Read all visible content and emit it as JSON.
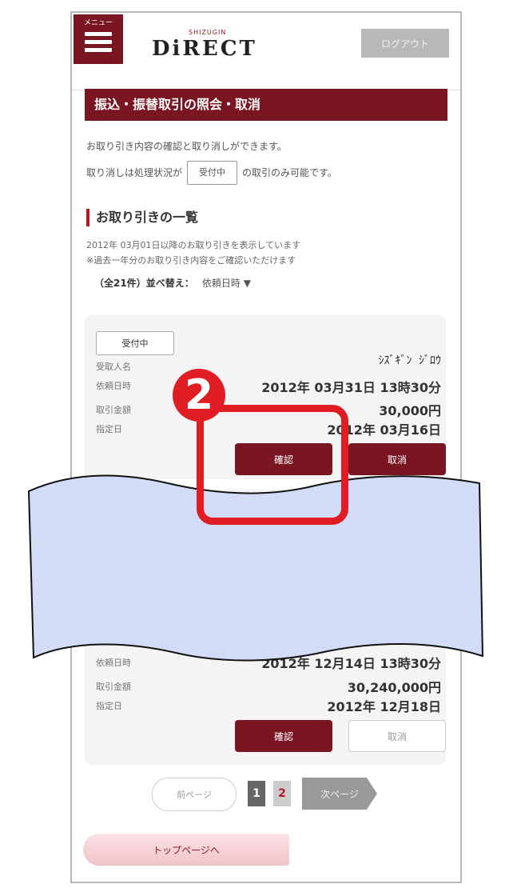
{
  "header": {
    "menu_label": "メニュー",
    "logo_small": "SHIZUGIN",
    "logo_main": "DiRECT",
    "logout_label": "ログアウト"
  },
  "page": {
    "title": "振込・振替取引の照会・取消",
    "desc_line1": "お取り引き内容の確認と取り消しができます。",
    "desc_line2_prefix": "取り消しは処理状況が",
    "desc_line2_badge": "受付中",
    "desc_line2_suffix": "の取引のみ可能です。"
  },
  "list": {
    "section_title": "お取り引きの一覧",
    "note_line1": "2012年 03月01日以降のお取り引きを表示しています",
    "note_line2": "※過去一年分のお取り引き内容をご確認いただけます",
    "count_label": "（全21件）並べ替え：",
    "sort_value": "依頼日時 ▼"
  },
  "transactions": [
    {
      "status": "受付中",
      "payee_label": "受取人名",
      "payee_value": "ｼｽﾞｷﾞﾝ ｼﾞﾛｳ",
      "requested_label": "依頼日時",
      "requested_value": "2012年 03月31日 13時30分",
      "amount_label": "取引金額",
      "amount_value": "30,000円",
      "date_label": "指定日",
      "date_value": "2012年 03月16日",
      "confirm_label": "確認",
      "cancel_label": "取消",
      "cancel_enabled": true
    },
    {
      "requested_label": "依頼日時",
      "requested_value": "2012年 12月14日 13時30分",
      "amount_label": "取引金額",
      "amount_value": "30,240,000円",
      "date_label": "指定日",
      "date_value": "2012年 12月18日",
      "confirm_label": "確認",
      "cancel_label": "取消",
      "cancel_enabled": false
    }
  ],
  "pager": {
    "prev_label": "前ページ",
    "pages": [
      "1",
      "2"
    ],
    "current_page": "1",
    "next_label": "次ページ"
  },
  "footer": {
    "top_page_label": "トップページへ"
  },
  "annotation": {
    "step_number": "2",
    "highlight_color": "#e01d25",
    "wave_color": "#d3dcf6"
  },
  "colors": {
    "brand": "#7a1522",
    "accent_red": "#b21a2a"
  }
}
